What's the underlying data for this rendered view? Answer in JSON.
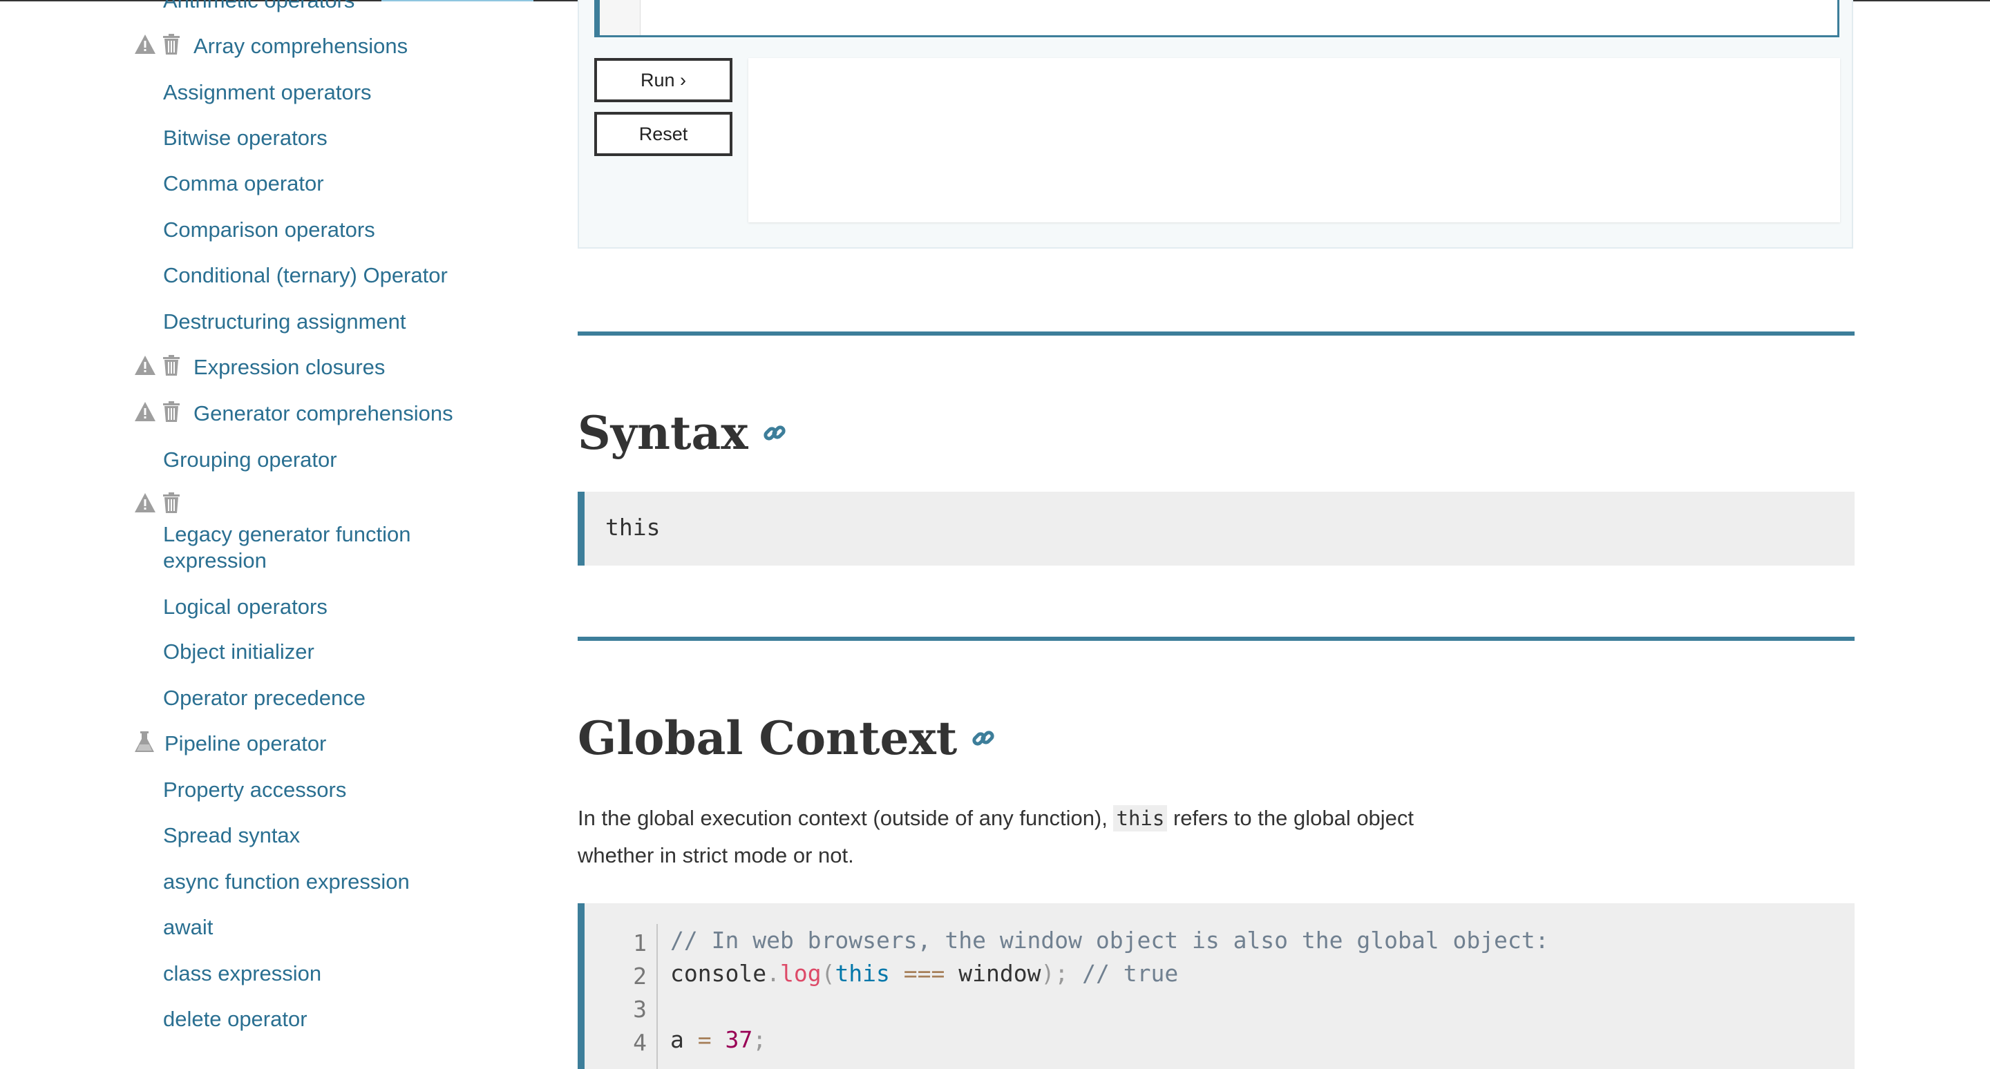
{
  "sidebar": {
    "cut_off_item": "Arithmetic operators",
    "items": [
      {
        "label": "Array comprehensions",
        "flags": [
          "warning",
          "deprecated"
        ]
      },
      {
        "label": "Assignment operators",
        "flags": []
      },
      {
        "label": "Bitwise operators",
        "flags": []
      },
      {
        "label": "Comma operator",
        "flags": []
      },
      {
        "label": "Comparison operators",
        "flags": []
      },
      {
        "label": "Conditional (ternary) Operator",
        "flags": []
      },
      {
        "label": "Destructuring assignment",
        "flags": []
      },
      {
        "label": "Expression closures",
        "flags": [
          "warning",
          "deprecated"
        ]
      },
      {
        "label": "Generator comprehensions",
        "flags": [
          "warning",
          "deprecated"
        ]
      },
      {
        "label": "Grouping operator",
        "flags": []
      },
      {
        "label": "Legacy generator function expression",
        "flags": [
          "warning",
          "deprecated"
        ]
      },
      {
        "label": "Logical operators",
        "flags": []
      },
      {
        "label": "Object initializer",
        "flags": []
      },
      {
        "label": "Operator precedence",
        "flags": []
      },
      {
        "label": "Pipeline operator",
        "flags": [
          "experimental"
        ]
      },
      {
        "label": "Property accessors",
        "flags": []
      },
      {
        "label": "Spread syntax",
        "flags": []
      },
      {
        "label": "async function expression",
        "flags": []
      },
      {
        "label": "await",
        "flags": []
      },
      {
        "label": "class expression",
        "flags": []
      },
      {
        "label": "delete operator",
        "flags": []
      }
    ]
  },
  "editor": {
    "run_label": "Run ›",
    "reset_label": "Reset"
  },
  "sections": {
    "syntax_heading": "Syntax",
    "syntax_code": "this",
    "global_heading": "Global Context",
    "global_text_before": "In the global execution context (outside of any function), ",
    "global_text_code": "this",
    "global_text_after": " refers to the global object whether in strict mode or not."
  },
  "code_example": {
    "line_numbers": [
      "1",
      "2",
      "3",
      "4"
    ],
    "line1_comment": "// In web browsers, the window object is also the global object:",
    "line2": {
      "obj": "console",
      "dot": ".",
      "fn": "log",
      "open": "(",
      "kw": "this",
      "op": "===",
      "arg": "window",
      "close": ");",
      "comment": "// true"
    },
    "line4": {
      "var": "a",
      "op": "=",
      "num": "37",
      "end": ";"
    }
  },
  "colors": {
    "link": "#2a6f91",
    "accent": "#3d7e9a",
    "icon_grey": "#9e9e9e"
  },
  "icons": {
    "warning": "warning-triangle-icon",
    "deprecated": "trash-can-icon",
    "experimental": "flask-icon",
    "anchor": "link-icon"
  }
}
